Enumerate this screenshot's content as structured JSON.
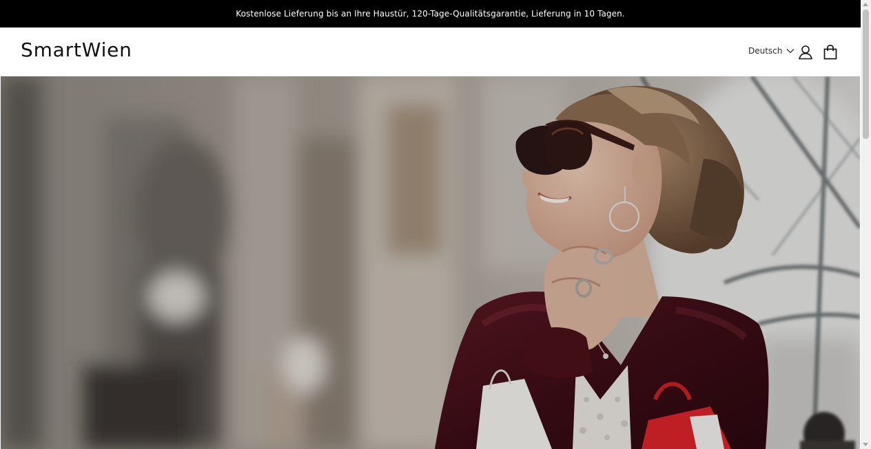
{
  "announcement": {
    "text": "Kostenlose Lieferung bis an Ihre Haustür, 120-Tage-Qualitätsgarantie, Lieferung in 10 Tagen."
  },
  "header": {
    "logo": "SmartWien",
    "language": "Deutsch",
    "icons": [
      "chevron-down-icon",
      "account-icon",
      "cart-icon"
    ]
  },
  "hero": {
    "image_subject": "woman-with-sunglasses-hero-image"
  },
  "colors": {
    "announcement_bg": "#000000",
    "announcement_text": "#ffffff",
    "text": "#121212"
  }
}
